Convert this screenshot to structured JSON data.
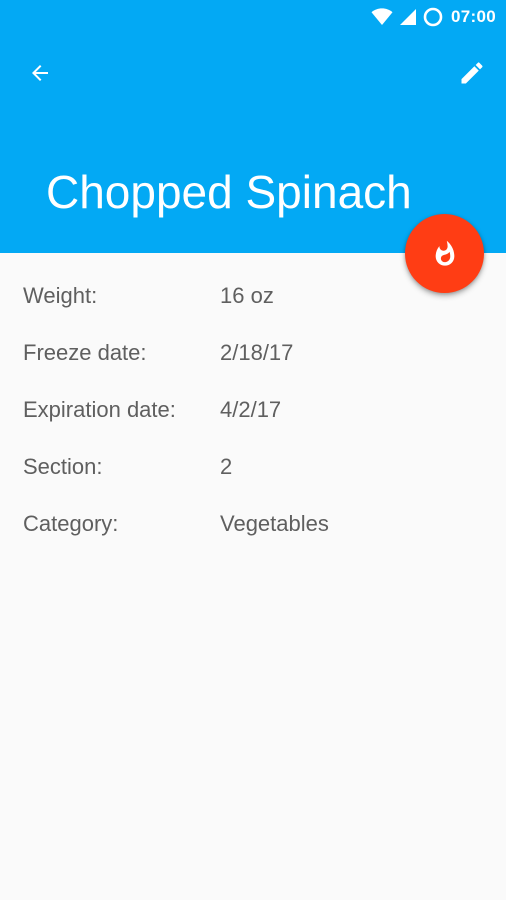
{
  "status_bar": {
    "time": "07:00",
    "icons": [
      "wifi-icon",
      "signal-icon",
      "battery-saver-icon"
    ]
  },
  "toolbar": {
    "back_icon": "arrow-back-icon",
    "edit_icon": "pencil-icon"
  },
  "item": {
    "title": "Chopped Spinach"
  },
  "fab": {
    "icon": "flame-icon",
    "color": "#ff3d14"
  },
  "details": [
    {
      "label": "Weight:",
      "value": "16 oz"
    },
    {
      "label": "Freeze date:",
      "value": "2/18/17"
    },
    {
      "label": "Expiration date:",
      "value": "4/2/17"
    },
    {
      "label": "Section:",
      "value": "2"
    },
    {
      "label": "Category:",
      "value": "Vegetables"
    }
  ],
  "colors": {
    "app_bar": "#03a9f4",
    "background": "#fafafa",
    "text": "#5f5f5f"
  }
}
